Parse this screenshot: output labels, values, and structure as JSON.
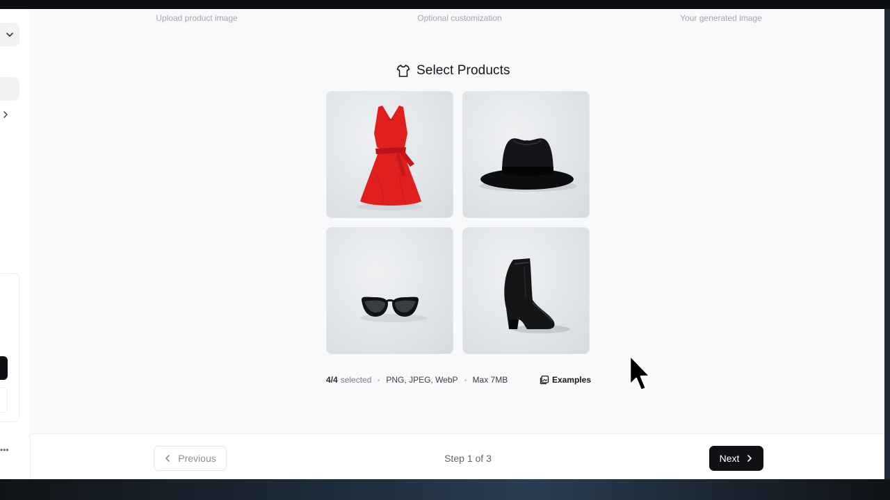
{
  "wizard": {
    "steps": [
      {
        "label": "Upload product image"
      },
      {
        "label": "Optional customization"
      },
      {
        "label": "Your generated image"
      }
    ]
  },
  "section": {
    "title": "Select Products",
    "icon": "shirt-icon"
  },
  "products": [
    {
      "name": "red-dress",
      "icon": "red-dress-image"
    },
    {
      "name": "black-hat",
      "icon": "black-fedora-image"
    },
    {
      "name": "sunglasses",
      "icon": "sunglasses-image"
    },
    {
      "name": "ankle-boot",
      "icon": "ankle-boot-image"
    }
  ],
  "meta": {
    "count": "4/4",
    "selected_label": "selected",
    "formats": "PNG, JPEG, WebP",
    "max_size": "Max 7MB",
    "examples_label": "Examples",
    "examples_icon": "images-icon"
  },
  "footer": {
    "previous_label": "Previous",
    "step_text": "Step 1 of 3",
    "next_label": "Next"
  },
  "colors": {
    "accent_dark": "#0f1114",
    "muted_text": "#a3a7ad",
    "dress_red": "#e0201f"
  }
}
